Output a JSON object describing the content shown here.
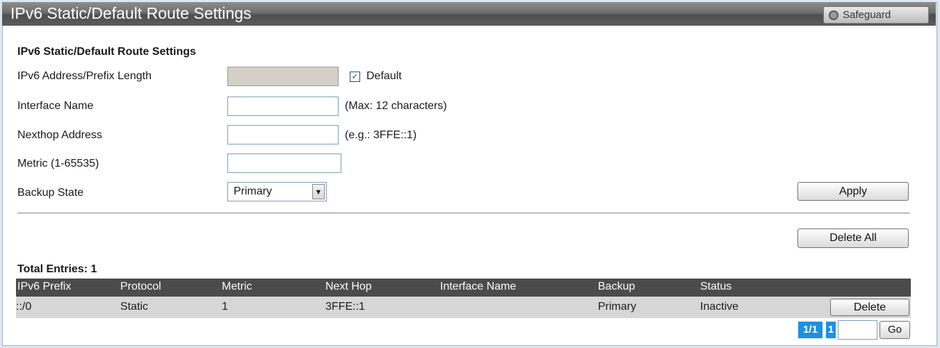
{
  "header": {
    "title": "IPv6 Static/Default Route Settings",
    "safeguard_label": "Safeguard"
  },
  "form": {
    "section_title": "IPv6 Static/Default Route Settings",
    "prefix_label": "IPv6 Address/Prefix Length",
    "prefix_value": "",
    "default_checked": true,
    "default_label": "Default",
    "interface_label": "Interface Name",
    "interface_value": "",
    "interface_hint": "(Max: 12 characters)",
    "nexthop_label": "Nexthop Address",
    "nexthop_value": "",
    "nexthop_hint": "(e.g.: 3FFE::1)",
    "metric_label": "Metric (1-65535)",
    "metric_value": "",
    "backup_label": "Backup State",
    "backup_value": "Primary",
    "apply_label": "Apply",
    "delete_all_label": "Delete All"
  },
  "table": {
    "total_entries": "Total Entries: 1",
    "columns": [
      "IPv6 Prefix",
      "Protocol",
      "Metric",
      "Next Hop",
      "Interface Name",
      "Backup",
      "Status"
    ],
    "rows": [
      {
        "prefix": "::/0",
        "protocol": "Static",
        "metric": "1",
        "next_hop": "3FFE::1",
        "interface": "",
        "backup": "Primary",
        "status": "Inactive",
        "action": "Delete"
      }
    ]
  },
  "pagination": {
    "page_info": "1/1",
    "current_page": "1",
    "go_label": "Go"
  },
  "colors": {
    "header_bar": "#5c5c5c",
    "table_header": "#4b4b4b",
    "row_bg": "#d7d7d7",
    "page_badge": "#1e90e0"
  }
}
